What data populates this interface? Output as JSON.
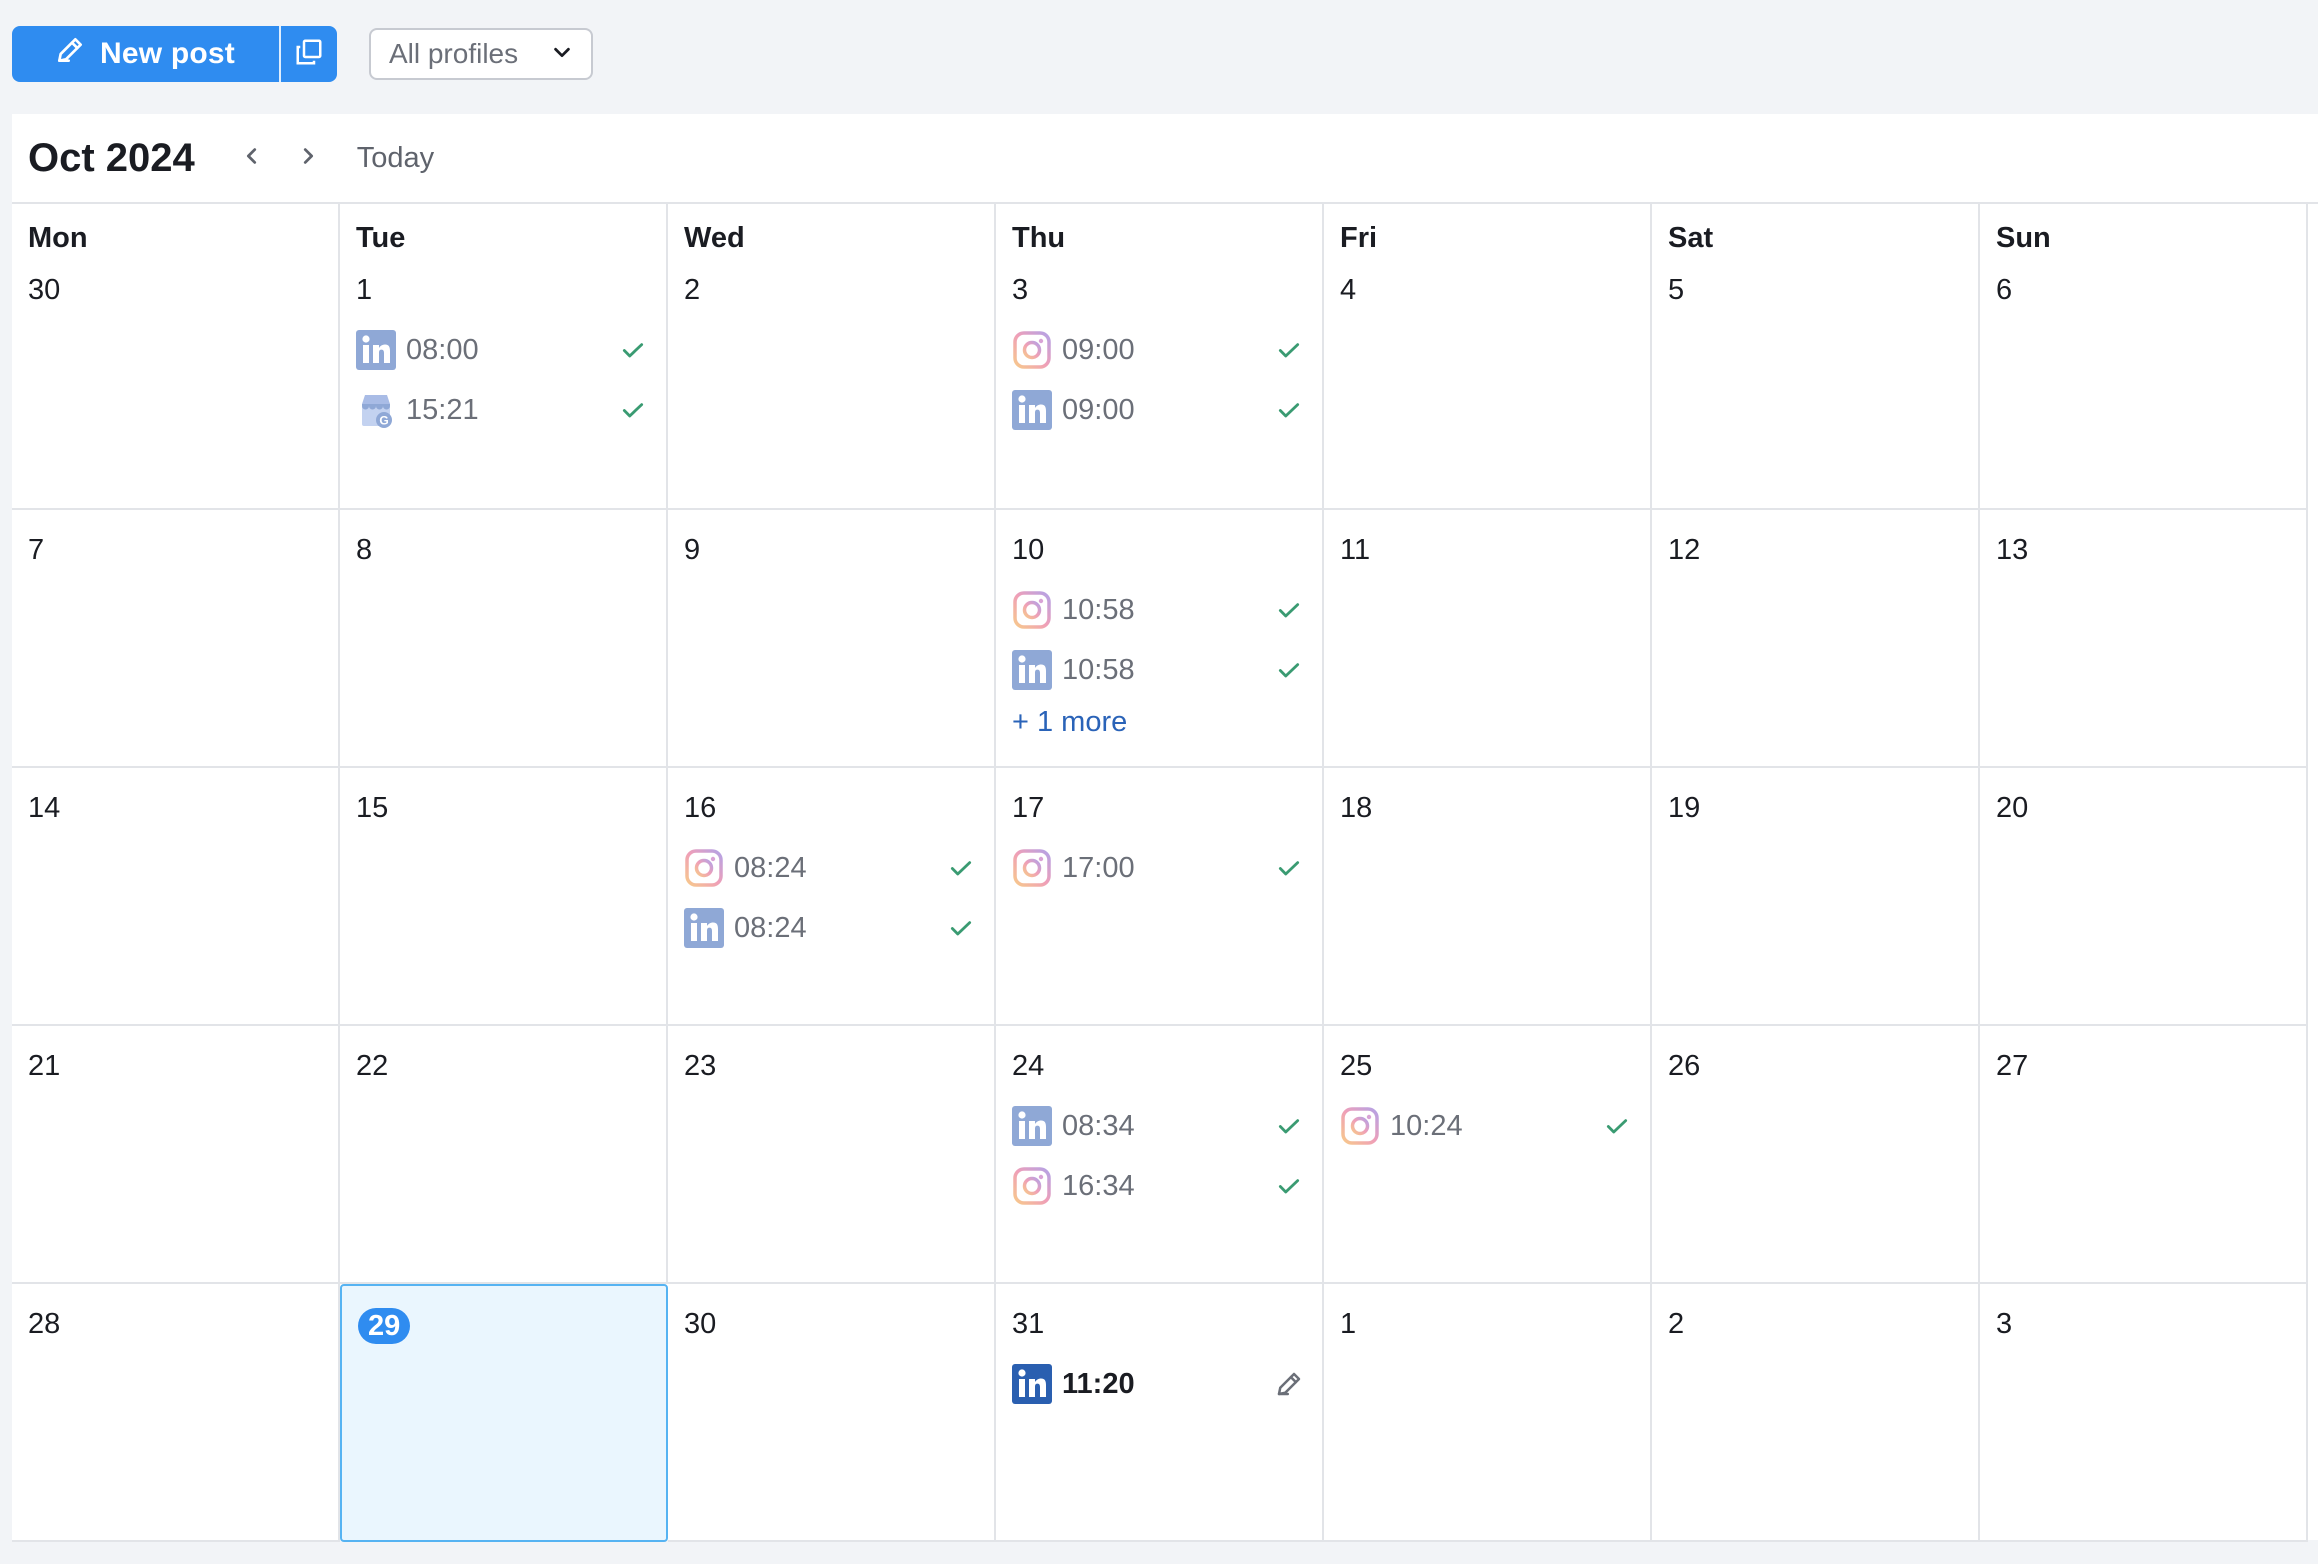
{
  "toolbar": {
    "new_post_label": "New post",
    "profiles_selected": "All profiles"
  },
  "calendar": {
    "month_title": "Oct 2024",
    "today_label": "Today",
    "weekdays": [
      "Mon",
      "Tue",
      "Wed",
      "Thu",
      "Fri",
      "Sat",
      "Sun"
    ],
    "weeks": [
      {
        "days": [
          "30",
          "1",
          "2",
          "3",
          "4",
          "5",
          "6"
        ]
      },
      {
        "days": [
          "7",
          "8",
          "9",
          "10",
          "11",
          "12",
          "13"
        ]
      },
      {
        "days": [
          "14",
          "15",
          "16",
          "17",
          "18",
          "19",
          "20"
        ]
      },
      {
        "days": [
          "21",
          "22",
          "23",
          "24",
          "25",
          "26",
          "27"
        ]
      },
      {
        "days": [
          "28",
          "29",
          "30",
          "31",
          "1",
          "2",
          "3"
        ]
      }
    ],
    "today": "29",
    "posts": {
      "oct1": [
        {
          "network": "linkedin-icon",
          "time": "08:00",
          "status": "published"
        },
        {
          "network": "google-business-icon",
          "time": "15:21",
          "status": "published"
        }
      ],
      "oct3": [
        {
          "network": "instagram-icon",
          "time": "09:00",
          "status": "published"
        },
        {
          "network": "linkedin-icon",
          "time": "09:00",
          "status": "published"
        }
      ],
      "oct10": [
        {
          "network": "instagram-icon",
          "time": "10:58",
          "status": "published"
        },
        {
          "network": "linkedin-icon",
          "time": "10:58",
          "status": "published"
        }
      ],
      "oct10_more": "+ 1 more",
      "oct16": [
        {
          "network": "instagram-icon",
          "time": "08:24",
          "status": "published"
        },
        {
          "network": "linkedin-icon",
          "time": "08:24",
          "status": "published"
        }
      ],
      "oct17": [
        {
          "network": "instagram-icon",
          "time": "17:00",
          "status": "published"
        }
      ],
      "oct24": [
        {
          "network": "linkedin-icon",
          "time": "08:34",
          "status": "published"
        },
        {
          "network": "instagram-icon",
          "time": "16:34",
          "status": "published"
        }
      ],
      "oct25": [
        {
          "network": "instagram-icon",
          "time": "10:24",
          "status": "published"
        }
      ],
      "oct31": [
        {
          "network": "linkedin-icon",
          "time": "11:20",
          "status": "draft"
        }
      ]
    }
  },
  "colors": {
    "accent": "#2f8cf0",
    "published_check": "#3a9b72",
    "more_link": "#2a63b8",
    "today_bg": "#eaf6fe",
    "today_border": "#56b3f2",
    "linkedin_muted": "#8fa8d6",
    "linkedin": "#2a5fb0"
  }
}
